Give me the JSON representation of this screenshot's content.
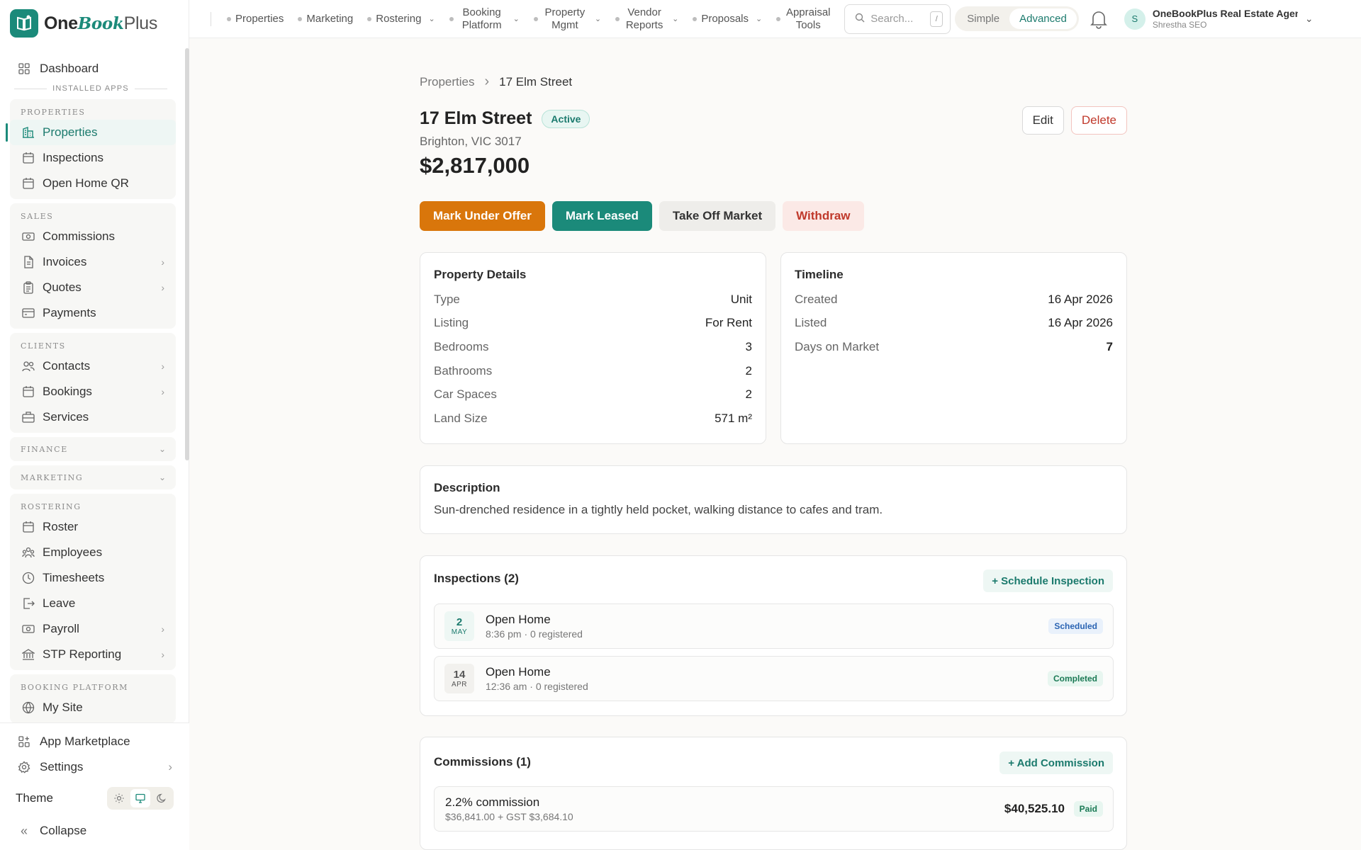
{
  "brand": {
    "one": "One",
    "book": "Book",
    "plus": "Plus"
  },
  "sidebar": {
    "dashboard": "Dashboard",
    "installed_apps": "INSTALLED APPS",
    "groups": {
      "properties": {
        "title": "Properties",
        "items": [
          "Properties",
          "Inspections",
          "Open Home QR"
        ]
      },
      "sales": {
        "title": "Sales",
        "items": [
          "Commissions",
          "Invoices",
          "Quotes",
          "Payments"
        ]
      },
      "clients": {
        "title": "Clients",
        "items": [
          "Contacts",
          "Bookings",
          "Services"
        ]
      },
      "finance": {
        "title": "Finance"
      },
      "marketing": {
        "title": "Marketing"
      },
      "rostering": {
        "title": "Rostering",
        "items": [
          "Roster",
          "Employees",
          "Timesheets",
          "Leave",
          "Payroll",
          "STP Reporting"
        ]
      },
      "booking": {
        "title": "Booking Platform",
        "items": [
          "My Site"
        ]
      }
    },
    "bottom": {
      "marketplace": "App Marketplace",
      "settings": "Settings",
      "theme": "Theme",
      "collapse": "Collapse"
    }
  },
  "topnav": {
    "items": [
      "Properties",
      "Marketing",
      "Rostering",
      "Booking Platform",
      "Property Mgmt",
      "Vendor Reports",
      "Proposals",
      "Appraisal Tools"
    ],
    "search_placeholder": "Search...",
    "search_shortcut": "/",
    "mode_simple": "Simple",
    "mode_advanced": "Advanced",
    "account_initial": "S",
    "account_name": "OneBookPlus Real Estate Agency",
    "account_user": "Shrestha SEO"
  },
  "property": {
    "breadcrumb_root": "Properties",
    "breadcrumb_current": "17 Elm Street",
    "title": "17 Elm Street",
    "status": "Active",
    "address": "Brighton, VIC 3017",
    "price": "$2,817,000",
    "edit": "Edit",
    "delete": "Delete",
    "actions": {
      "under_offer": "Mark Under Offer",
      "leased": "Mark Leased",
      "off_market": "Take Off Market",
      "withdraw": "Withdraw"
    },
    "details_title": "Property Details",
    "details": [
      {
        "k": "Type",
        "v": "Unit"
      },
      {
        "k": "Listing",
        "v": "For Rent"
      },
      {
        "k": "Bedrooms",
        "v": "3"
      },
      {
        "k": "Bathrooms",
        "v": "2"
      },
      {
        "k": "Car Spaces",
        "v": "2"
      },
      {
        "k": "Land Size",
        "v": "571 m²"
      }
    ],
    "timeline_title": "Timeline",
    "timeline": [
      {
        "k": "Created",
        "v": "16 Apr 2026"
      },
      {
        "k": "Listed",
        "v": "16 Apr 2026"
      },
      {
        "k": "Days on Market",
        "v": "7"
      }
    ],
    "description_title": "Description",
    "description": "Sun-drenched residence in a tightly held pocket, walking distance to cafes and tram.",
    "inspections_title": "Inspections (2)",
    "schedule_btn": "+ Schedule Inspection",
    "inspections": [
      {
        "day": "2",
        "month": "MAY",
        "title": "Open Home",
        "sub": "8:36 pm · 0 registered",
        "status": "Scheduled"
      },
      {
        "day": "14",
        "month": "APR",
        "title": "Open Home",
        "sub": "12:36 am · 0 registered",
        "status": "Completed"
      }
    ],
    "commissions_title": "Commissions (1)",
    "add_commission_btn": "+ Add Commission",
    "commission": {
      "title": "2.2% commission",
      "sub": "$36,841.00 + GST $3,684.10",
      "amount": "$40,525.10",
      "status": "Paid"
    }
  },
  "colors": {
    "accent": "#1b8a7a",
    "orange": "#d9760b",
    "danger": "#c0392b"
  }
}
